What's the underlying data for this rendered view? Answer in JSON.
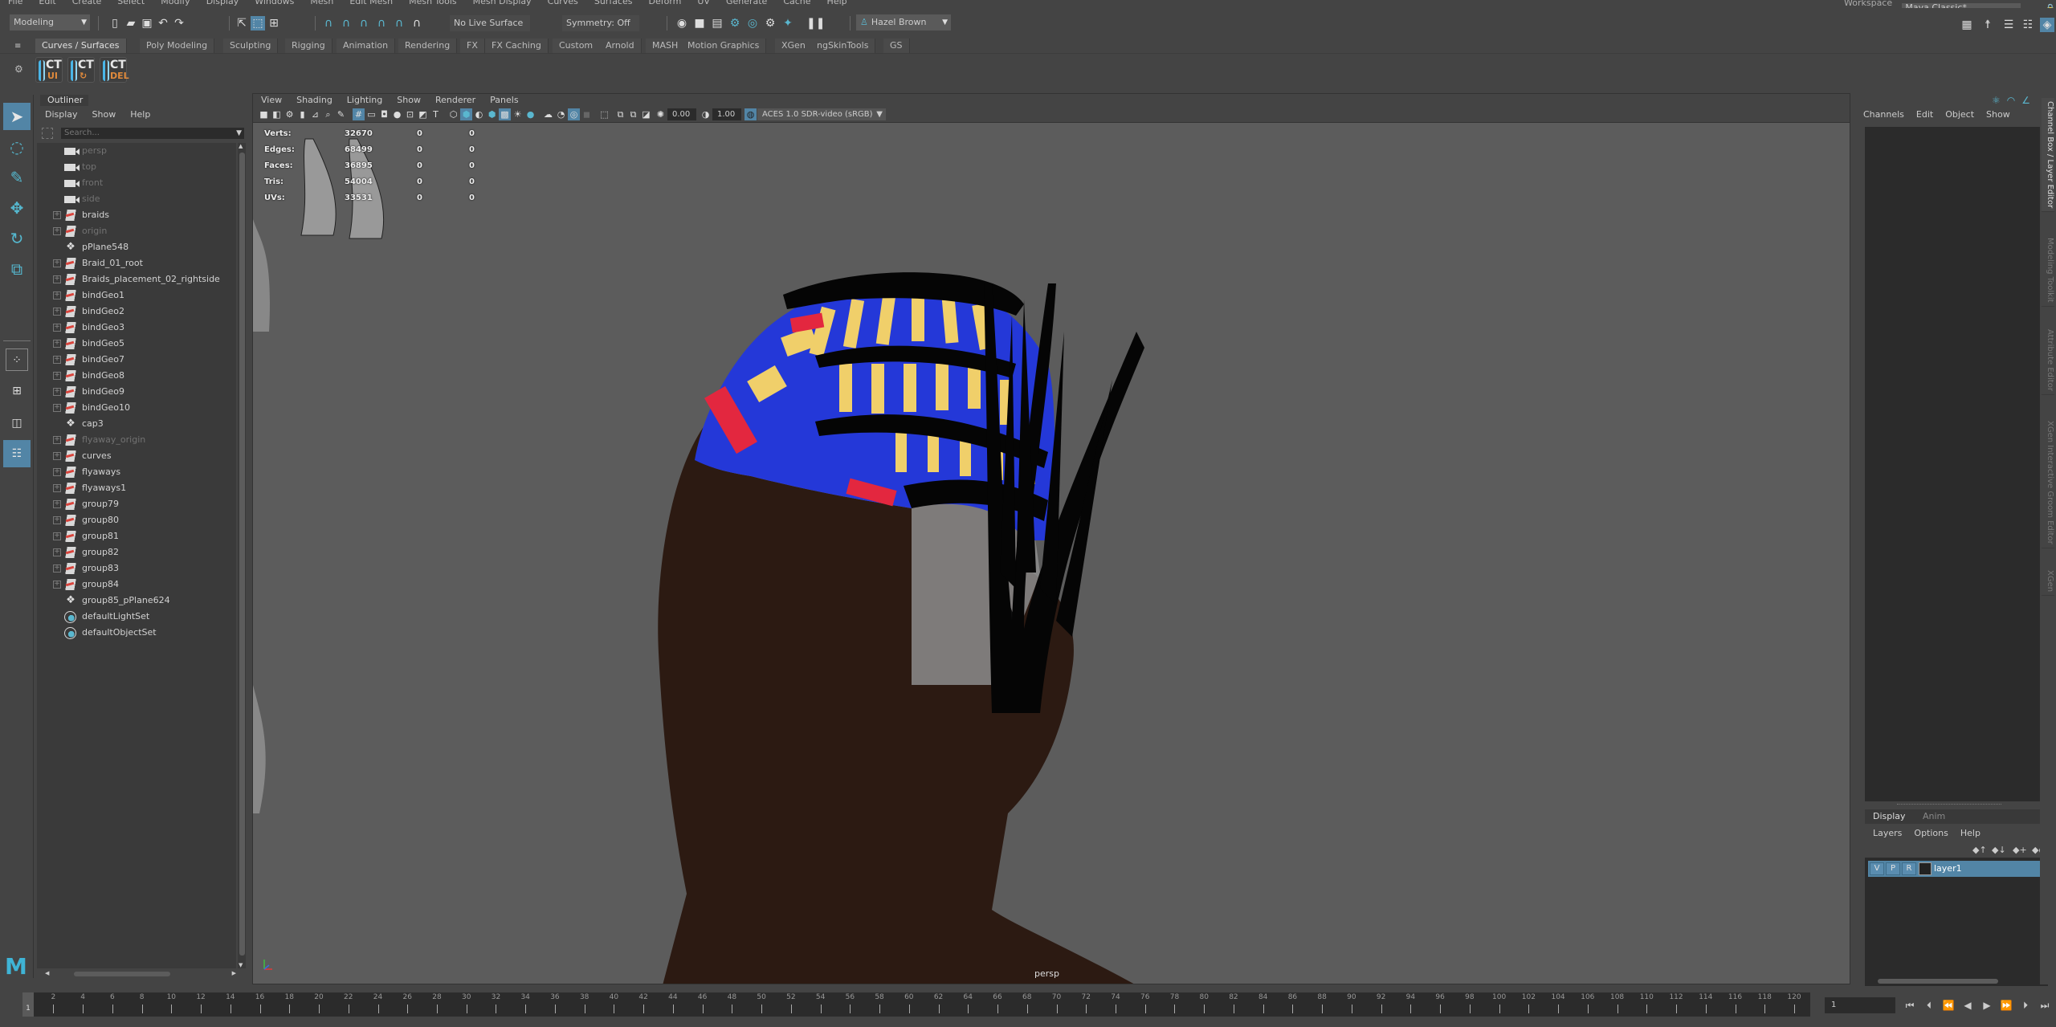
{
  "menubar": {
    "items": [
      "File",
      "Edit",
      "Create",
      "Select",
      "Modify",
      "Display",
      "Windows",
      "Mesh",
      "Edit Mesh",
      "Mesh Tools",
      "Mesh Display",
      "Curves",
      "Surfaces",
      "Deform",
      "UV",
      "Generate",
      "Cache",
      "Help"
    ],
    "workspace_label": "Workspace :",
    "workspace_value": "Maya Classic*"
  },
  "statusline": {
    "menuset": "Modeling",
    "live_surface": "No Live Surface",
    "symmetry": "Symmetry: Off",
    "user": "Hazel Brown"
  },
  "shelf": {
    "tabs": [
      "Curves / Surfaces",
      "Poly Modeling",
      "Sculpting",
      "Rigging",
      "Animation",
      "Rendering",
      "FX",
      "FX Caching",
      "Custom",
      "Arnold",
      "MASH",
      "Motion Graphics",
      "XGen",
      "ngSkinTools",
      "GS"
    ],
    "active_tab": "Curves / Surfaces",
    "buttons": [
      {
        "label": "CT",
        "sub": "UI"
      },
      {
        "label": "CT",
        "sub": "↻"
      },
      {
        "label": "CT",
        "sub": "DEL"
      }
    ]
  },
  "outliner": {
    "title": "Outliner",
    "menu": [
      "Display",
      "Show",
      "Help"
    ],
    "search_placeholder": "Search...",
    "items": [
      {
        "name": "persp",
        "type": "camera",
        "dim": true,
        "expandable": false
      },
      {
        "name": "top",
        "type": "camera",
        "dim": true,
        "expandable": false
      },
      {
        "name": "front",
        "type": "camera",
        "dim": true,
        "expandable": false
      },
      {
        "name": "side",
        "type": "camera",
        "dim": true,
        "expandable": false
      },
      {
        "name": "braids",
        "type": "transform",
        "dim": false,
        "expandable": true
      },
      {
        "name": "origin",
        "type": "transform",
        "dim": true,
        "expandable": true
      },
      {
        "name": "pPlane548",
        "type": "mesh",
        "dim": false,
        "expandable": false
      },
      {
        "name": "Braid_01_root",
        "type": "transform",
        "dim": false,
        "expandable": true
      },
      {
        "name": "Braids_placement_02_rightside",
        "type": "transform",
        "dim": false,
        "expandable": true
      },
      {
        "name": "bindGeo1",
        "type": "transform",
        "dim": false,
        "expandable": true
      },
      {
        "name": "bindGeo2",
        "type": "transform",
        "dim": false,
        "expandable": true
      },
      {
        "name": "bindGeo3",
        "type": "transform",
        "dim": false,
        "expandable": true
      },
      {
        "name": "bindGeo5",
        "type": "transform",
        "dim": false,
        "expandable": true
      },
      {
        "name": "bindGeo7",
        "type": "transform",
        "dim": false,
        "expandable": true
      },
      {
        "name": "bindGeo8",
        "type": "transform",
        "dim": false,
        "expandable": true
      },
      {
        "name": "bindGeo9",
        "type": "transform",
        "dim": false,
        "expandable": true
      },
      {
        "name": "bindGeo10",
        "type": "transform",
        "dim": false,
        "expandable": true
      },
      {
        "name": "cap3",
        "type": "mesh",
        "dim": false,
        "expandable": false
      },
      {
        "name": "flyaway_origin",
        "type": "transform",
        "dim": true,
        "expandable": true
      },
      {
        "name": "curves",
        "type": "transform",
        "dim": false,
        "expandable": true
      },
      {
        "name": "flyaways",
        "type": "transform",
        "dim": false,
        "expandable": true
      },
      {
        "name": "flyaways1",
        "type": "transform",
        "dim": false,
        "expandable": true
      },
      {
        "name": "group79",
        "type": "transform",
        "dim": false,
        "expandable": true
      },
      {
        "name": "group80",
        "type": "transform",
        "dim": false,
        "expandable": true
      },
      {
        "name": "group81",
        "type": "transform",
        "dim": false,
        "expandable": true
      },
      {
        "name": "group82",
        "type": "transform",
        "dim": false,
        "expandable": true
      },
      {
        "name": "group83",
        "type": "transform",
        "dim": false,
        "expandable": true
      },
      {
        "name": "group84",
        "type": "transform",
        "dim": false,
        "expandable": true
      },
      {
        "name": "group85_pPlane624",
        "type": "mesh",
        "dim": false,
        "expandable": false
      },
      {
        "name": "defaultLightSet",
        "type": "set",
        "dim": false,
        "expandable": false
      },
      {
        "name": "defaultObjectSet",
        "type": "set",
        "dim": false,
        "expandable": false
      }
    ]
  },
  "viewport": {
    "menu": [
      "View",
      "Shading",
      "Lighting",
      "Show",
      "Renderer",
      "Panels"
    ],
    "exposure": "0.00",
    "gamma": "1.00",
    "color_space": "ACES 1.0 SDR-video (sRGB)",
    "camera_label": "persp",
    "hud": [
      {
        "label": "Verts:",
        "value": "32670",
        "sel": "0",
        "uv": "0"
      },
      {
        "label": "Edges:",
        "value": "68499",
        "sel": "0",
        "uv": "0"
      },
      {
        "label": "Faces:",
        "value": "36895",
        "sel": "0",
        "uv": "0"
      },
      {
        "label": "Tris:",
        "value": "54004",
        "sel": "0",
        "uv": "0"
      },
      {
        "label": "UVs:",
        "value": "33531",
        "sel": "0",
        "uv": "0"
      }
    ],
    "colors": {
      "background": "#5c5c5c",
      "skin": "#2c1a12",
      "braid_blue": "#2438d8",
      "braid_yellow": "#f0cf6a",
      "braid_red": "#e3273f",
      "braid_black": "#050505",
      "fade_hair": "#8a8a8a"
    }
  },
  "channelbox": {
    "menu": [
      "Channels",
      "Edit",
      "Object",
      "Show"
    ]
  },
  "layereditor": {
    "tabs": [
      "Display",
      "Anim"
    ],
    "active_tab": "Display",
    "menu": [
      "Layers",
      "Options",
      "Help"
    ],
    "layers": [
      {
        "v": "V",
        "p": "P",
        "r": "R",
        "name": "layer1"
      }
    ]
  },
  "side_tabs": [
    "Channel Box / Layer Editor",
    "Modeling Toolkit",
    "Attribute Editor",
    "XGen Interactive Groom Editor",
    "XGen"
  ],
  "timeline": {
    "start": 1,
    "end": 120,
    "tick_labels": [
      2,
      4,
      6,
      8,
      10,
      12,
      14,
      16,
      18,
      20,
      22,
      24,
      26,
      28,
      30,
      32,
      34,
      36,
      38,
      40,
      42,
      44,
      46,
      48,
      50,
      52,
      54,
      56,
      58,
      60,
      62,
      64,
      66,
      68,
      70,
      72,
      74,
      76,
      78,
      80,
      82,
      84,
      86,
      88,
      90,
      92,
      94,
      96,
      98,
      100,
      102,
      104,
      106,
      108,
      110,
      112,
      114,
      116,
      118,
      120
    ],
    "current_frame": "1",
    "current_frame_marker": "1"
  },
  "accent_color": "#5285a6"
}
